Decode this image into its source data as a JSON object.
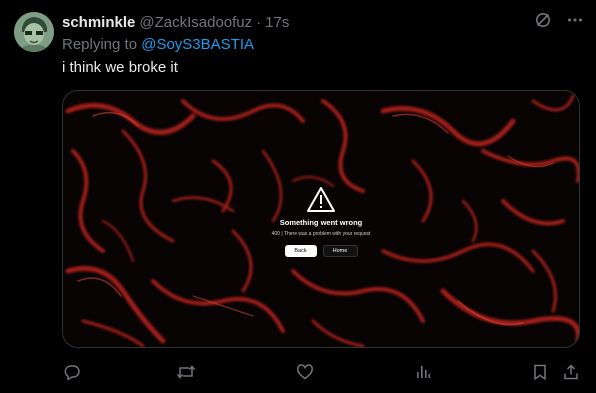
{
  "tweet": {
    "display_name": "schminkle",
    "handle": "@ZackIsadoofuz",
    "separator": "·",
    "time": "17s",
    "replying_prefix": "Replying to",
    "replying_to": "@SoyS3BASTIA",
    "text": "i think we broke it"
  },
  "media": {
    "error_title": "Something went wrong",
    "error_subtitle": "400 | There was a problem with your request",
    "back_label": "Back",
    "home_label": "Home"
  },
  "actions": {
    "icons": [
      "reply-icon",
      "retweet-icon",
      "like-icon",
      "views-icon",
      "bookmark-icon",
      "share-icon"
    ]
  },
  "colors": {
    "background": "#000000",
    "text_primary": "#e7e9ea",
    "text_secondary": "#71767b",
    "accent": "#1d9bf0",
    "media_red": "#b3241b"
  }
}
